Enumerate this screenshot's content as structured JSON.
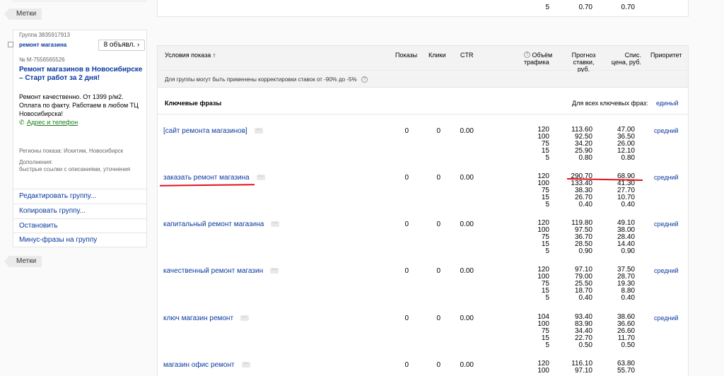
{
  "left": {
    "tag_top": "Метки",
    "tag_bottom": "Метки",
    "group_label": "Группа 3835917913",
    "group_name": "ремонт магазина",
    "ads_button": "8 объявл.",
    "ads_button_icon": "chevron-right-icon",
    "ad_id": "№ M-7556565526",
    "ad_title": "Ремонт магазинов в Новосибирске – Старт работ за 2 дня!",
    "ad_text": "Ремонт качественно. От 1399 р/м2. Оплата по факту. Работаем в любом ТЦ Новосибирска!",
    "address_link": "Адрес и телефон",
    "regions": "Регионы показа: Искитим, Новосибирск",
    "extras_label": "Дополнения:",
    "extras_value": "быстрые ссылки с описаниями, уточнения",
    "actions": [
      "Редактировать группу...",
      "Копировать группу...",
      "Остановить",
      "Минус-фразы на группу"
    ]
  },
  "top_box": {
    "traffic": "5",
    "bid": "0.70",
    "price": "0.70"
  },
  "table": {
    "headers": {
      "conditions": "Условия показа ↑",
      "shows": "Показы",
      "clicks": "Клики",
      "ctr": "CTR",
      "traffic": "Объём трафика",
      "forecast": "Прогноз ставки, руб.",
      "price": "Спис. цена, руб.",
      "priority": "Приоритет"
    },
    "note": "Для группы могут быть применены корректировки ставок от -90% до -5%",
    "keywords_heading": "Ключевые фразы",
    "all_keywords_label": "Для всех ключевых фраз:",
    "all_keywords_value": "единый",
    "rows": [
      {
        "phrase": "[сайт ремонта магазинов]",
        "shows": "0",
        "clicks": "0",
        "ctr": "0.00",
        "traffic": [
          "120",
          "100",
          "75",
          "15",
          "5"
        ],
        "forecast": [
          "113.60",
          "92.50",
          "34.20",
          "25.90",
          "0.80"
        ],
        "price": [
          "47.00",
          "36.50",
          "26.00",
          "12.10",
          "0.80"
        ],
        "priority": "средний"
      },
      {
        "phrase": "заказать ремонт магазина",
        "shows": "0",
        "clicks": "0",
        "ctr": "0.00",
        "traffic": [
          "120",
          "100",
          "75",
          "15",
          "5"
        ],
        "forecast": [
          "290.70",
          "133.40",
          "38.30",
          "26.70",
          "0.40"
        ],
        "price": [
          "68.90",
          "41.30",
          "27.70",
          "10.70",
          "0.40"
        ],
        "priority": "средний"
      },
      {
        "phrase": "капитальный ремонт магазина",
        "shows": "0",
        "clicks": "0",
        "ctr": "0.00",
        "traffic": [
          "120",
          "100",
          "75",
          "15",
          "5"
        ],
        "forecast": [
          "119.80",
          "97.50",
          "36.70",
          "28.50",
          "0.90"
        ],
        "price": [
          "49.10",
          "38.00",
          "28.40",
          "14.40",
          "0.90"
        ],
        "priority": "средний"
      },
      {
        "phrase": "качественный ремонт магазин",
        "shows": "0",
        "clicks": "0",
        "ctr": "0.00",
        "traffic": [
          "120",
          "100",
          "75",
          "15",
          "5"
        ],
        "forecast": [
          "97.10",
          "79.00",
          "25.50",
          "18.70",
          "0.40"
        ],
        "price": [
          "37.50",
          "28.70",
          "19.30",
          "8.80",
          "0.40"
        ],
        "priority": "средний"
      },
      {
        "phrase": "ключ магазин ремонт",
        "shows": "0",
        "clicks": "0",
        "ctr": "0.00",
        "traffic": [
          "104",
          "100",
          "75",
          "15",
          "5"
        ],
        "forecast": [
          "93.40",
          "83.90",
          "34.40",
          "22.70",
          "0.50"
        ],
        "price": [
          "38.60",
          "36.60",
          "26.60",
          "11.70",
          "0.50"
        ],
        "priority": "средний"
      },
      {
        "phrase": "магазин офис ремонт",
        "shows": "0",
        "clicks": "0",
        "ctr": "0.00",
        "traffic": [
          "120",
          "100"
        ],
        "forecast": [
          "116.10",
          "97.10"
        ],
        "price": [
          "63.80",
          "55.70"
        ],
        "priority": ""
      }
    ]
  },
  "colors": {
    "link": "#0a3aa0",
    "highlight": "#e0121a",
    "green_link": "#1a7f1a"
  }
}
